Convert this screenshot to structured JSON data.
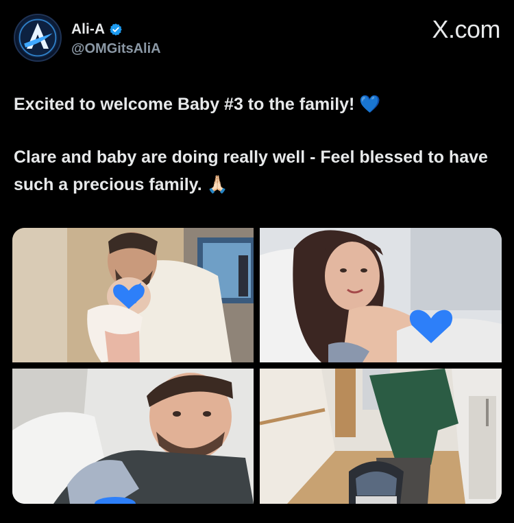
{
  "author": {
    "display_name": "Ali-A",
    "handle": "@OMGitsAliA",
    "verified": true,
    "avatar_icon": "ali-a-logo-icon"
  },
  "brand": "X.com",
  "tweet": {
    "line1": "Excited to welcome Baby #3 to the family!",
    "line1_emoji": "💙",
    "line2": "Clare and baby are doing really well - Feel blessed to have such a precious family.",
    "line2_emoji": "🙏🏻"
  },
  "media": {
    "photos": [
      {
        "description_icon": "father-kissing-baby-photo"
      },
      {
        "description_icon": "mother-in-hospital-bed-photo"
      },
      {
        "description_icon": "father-with-baby-selfie-photo"
      },
      {
        "description_icon": "hospital-corridor-car-seat-photo"
      }
    ]
  },
  "colors": {
    "background": "#000000",
    "text": "#e7e9ea",
    "secondary_text": "#8b98a5",
    "verified_blue": "#1d9bf0",
    "heart_blue": "#2d7ff9"
  }
}
